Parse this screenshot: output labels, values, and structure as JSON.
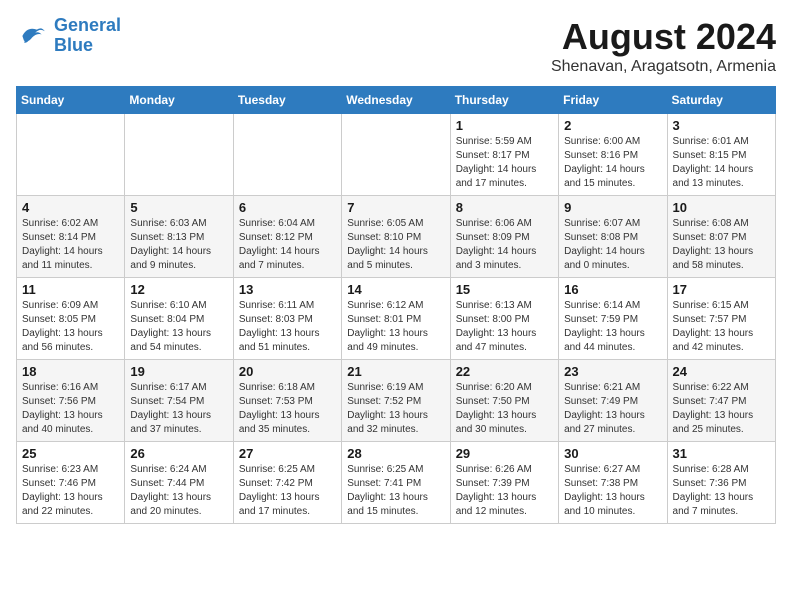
{
  "logo": {
    "line1": "General",
    "line2": "Blue"
  },
  "title": "August 2024",
  "subtitle": "Shenavan, Aragatsotn, Armenia",
  "weekdays": [
    "Sunday",
    "Monday",
    "Tuesday",
    "Wednesday",
    "Thursday",
    "Friday",
    "Saturday"
  ],
  "weeks": [
    [
      {
        "day": "",
        "info": ""
      },
      {
        "day": "",
        "info": ""
      },
      {
        "day": "",
        "info": ""
      },
      {
        "day": "",
        "info": ""
      },
      {
        "day": "1",
        "info": "Sunrise: 5:59 AM\nSunset: 8:17 PM\nDaylight: 14 hours\nand 17 minutes."
      },
      {
        "day": "2",
        "info": "Sunrise: 6:00 AM\nSunset: 8:16 PM\nDaylight: 14 hours\nand 15 minutes."
      },
      {
        "day": "3",
        "info": "Sunrise: 6:01 AM\nSunset: 8:15 PM\nDaylight: 14 hours\nand 13 minutes."
      }
    ],
    [
      {
        "day": "4",
        "info": "Sunrise: 6:02 AM\nSunset: 8:14 PM\nDaylight: 14 hours\nand 11 minutes."
      },
      {
        "day": "5",
        "info": "Sunrise: 6:03 AM\nSunset: 8:13 PM\nDaylight: 14 hours\nand 9 minutes."
      },
      {
        "day": "6",
        "info": "Sunrise: 6:04 AM\nSunset: 8:12 PM\nDaylight: 14 hours\nand 7 minutes."
      },
      {
        "day": "7",
        "info": "Sunrise: 6:05 AM\nSunset: 8:10 PM\nDaylight: 14 hours\nand 5 minutes."
      },
      {
        "day": "8",
        "info": "Sunrise: 6:06 AM\nSunset: 8:09 PM\nDaylight: 14 hours\nand 3 minutes."
      },
      {
        "day": "9",
        "info": "Sunrise: 6:07 AM\nSunset: 8:08 PM\nDaylight: 14 hours\nand 0 minutes."
      },
      {
        "day": "10",
        "info": "Sunrise: 6:08 AM\nSunset: 8:07 PM\nDaylight: 13 hours\nand 58 minutes."
      }
    ],
    [
      {
        "day": "11",
        "info": "Sunrise: 6:09 AM\nSunset: 8:05 PM\nDaylight: 13 hours\nand 56 minutes."
      },
      {
        "day": "12",
        "info": "Sunrise: 6:10 AM\nSunset: 8:04 PM\nDaylight: 13 hours\nand 54 minutes."
      },
      {
        "day": "13",
        "info": "Sunrise: 6:11 AM\nSunset: 8:03 PM\nDaylight: 13 hours\nand 51 minutes."
      },
      {
        "day": "14",
        "info": "Sunrise: 6:12 AM\nSunset: 8:01 PM\nDaylight: 13 hours\nand 49 minutes."
      },
      {
        "day": "15",
        "info": "Sunrise: 6:13 AM\nSunset: 8:00 PM\nDaylight: 13 hours\nand 47 minutes."
      },
      {
        "day": "16",
        "info": "Sunrise: 6:14 AM\nSunset: 7:59 PM\nDaylight: 13 hours\nand 44 minutes."
      },
      {
        "day": "17",
        "info": "Sunrise: 6:15 AM\nSunset: 7:57 PM\nDaylight: 13 hours\nand 42 minutes."
      }
    ],
    [
      {
        "day": "18",
        "info": "Sunrise: 6:16 AM\nSunset: 7:56 PM\nDaylight: 13 hours\nand 40 minutes."
      },
      {
        "day": "19",
        "info": "Sunrise: 6:17 AM\nSunset: 7:54 PM\nDaylight: 13 hours\nand 37 minutes."
      },
      {
        "day": "20",
        "info": "Sunrise: 6:18 AM\nSunset: 7:53 PM\nDaylight: 13 hours\nand 35 minutes."
      },
      {
        "day": "21",
        "info": "Sunrise: 6:19 AM\nSunset: 7:52 PM\nDaylight: 13 hours\nand 32 minutes."
      },
      {
        "day": "22",
        "info": "Sunrise: 6:20 AM\nSunset: 7:50 PM\nDaylight: 13 hours\nand 30 minutes."
      },
      {
        "day": "23",
        "info": "Sunrise: 6:21 AM\nSunset: 7:49 PM\nDaylight: 13 hours\nand 27 minutes."
      },
      {
        "day": "24",
        "info": "Sunrise: 6:22 AM\nSunset: 7:47 PM\nDaylight: 13 hours\nand 25 minutes."
      }
    ],
    [
      {
        "day": "25",
        "info": "Sunrise: 6:23 AM\nSunset: 7:46 PM\nDaylight: 13 hours\nand 22 minutes."
      },
      {
        "day": "26",
        "info": "Sunrise: 6:24 AM\nSunset: 7:44 PM\nDaylight: 13 hours\nand 20 minutes."
      },
      {
        "day": "27",
        "info": "Sunrise: 6:25 AM\nSunset: 7:42 PM\nDaylight: 13 hours\nand 17 minutes."
      },
      {
        "day": "28",
        "info": "Sunrise: 6:25 AM\nSunset: 7:41 PM\nDaylight: 13 hours\nand 15 minutes."
      },
      {
        "day": "29",
        "info": "Sunrise: 6:26 AM\nSunset: 7:39 PM\nDaylight: 13 hours\nand 12 minutes."
      },
      {
        "day": "30",
        "info": "Sunrise: 6:27 AM\nSunset: 7:38 PM\nDaylight: 13 hours\nand 10 minutes."
      },
      {
        "day": "31",
        "info": "Sunrise: 6:28 AM\nSunset: 7:36 PM\nDaylight: 13 hours\nand 7 minutes."
      }
    ]
  ]
}
